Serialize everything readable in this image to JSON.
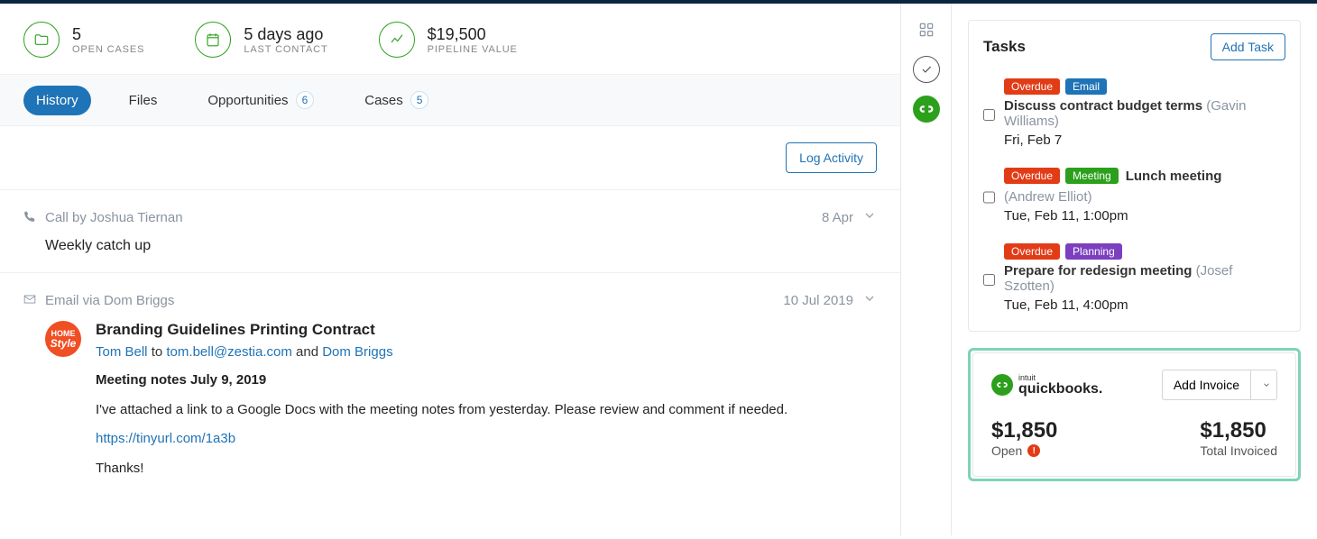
{
  "stats": [
    {
      "value": "5",
      "label": "OPEN CASES",
      "icon": "folder"
    },
    {
      "value": "5 days ago",
      "label": "LAST CONTACT",
      "icon": "calendar"
    },
    {
      "value": "$19,500",
      "label": "PIPELINE VALUE",
      "icon": "trend"
    }
  ],
  "tabs": {
    "history": "History",
    "files": "Files",
    "opportunities": {
      "label": "Opportunities",
      "count": "6"
    },
    "cases": {
      "label": "Cases",
      "count": "5"
    }
  },
  "log_activity": "Log Activity",
  "entries": {
    "call": {
      "meta": "Call by Joshua Tiernan",
      "date": "8 Apr",
      "subject": "Weekly catch up"
    },
    "email": {
      "meta": "Email via Dom Briggs",
      "date": "10 Jul 2019",
      "avatar_top": "HOME",
      "avatar_bottom": "Style",
      "subject": "Branding Guidelines Printing Contract",
      "from_name": "Tom Bell",
      "to_word": "to",
      "from_email": "tom.bell@zestia.com",
      "and_word": "and",
      "cc_name": "Dom Briggs",
      "notes_heading": "Meeting notes July 9, 2019",
      "body_line1": "I've attached a link to a Google Docs with the meeting notes from yesterday. Please review and comment if needed.",
      "link": "https://tinyurl.com/1a3b",
      "body_line2": "Thanks!"
    }
  },
  "tasks_panel": {
    "title": "Tasks",
    "add": "Add Task",
    "overdue": "Overdue",
    "email_tag": "Email",
    "meeting_tag": "Meeting",
    "planning_tag": "Planning",
    "items": [
      {
        "title": "Discuss contract budget terms",
        "who": "(Gavin Williams)",
        "date": "Fri, Feb 7"
      },
      {
        "title": "Lunch meeting",
        "who": "(Andrew Elliot)",
        "date": "Tue, Feb 11, 1:00pm"
      },
      {
        "title": "Prepare for redesign meeting",
        "who": "(Josef Szotten)",
        "date": "Tue, Feb 11, 4:00pm"
      }
    ]
  },
  "quickbooks": {
    "brand_tiny": "intuit",
    "brand_big": "quickbooks.",
    "add_invoice": "Add Invoice",
    "open_amount": "$1,850",
    "open_label": "Open",
    "total_amount": "$1,850",
    "total_label": "Total Invoiced"
  }
}
